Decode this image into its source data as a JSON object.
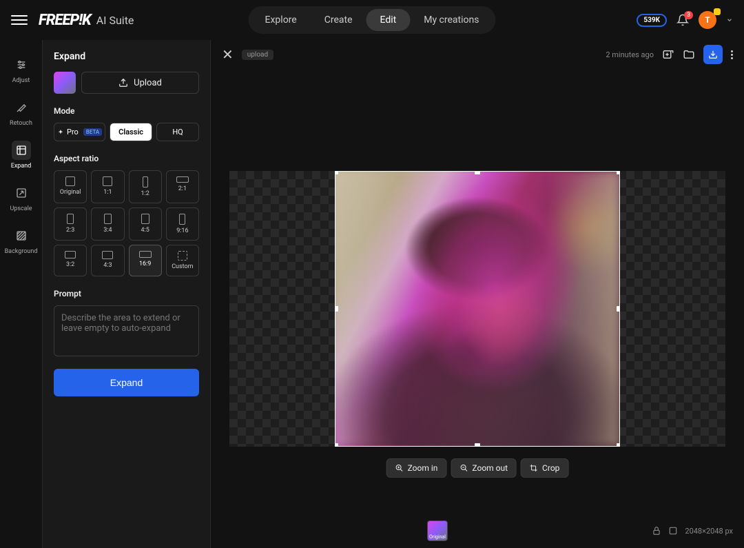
{
  "header": {
    "logo": "FREEP!K",
    "suite": "AI Suite",
    "nav": [
      "Explore",
      "Create",
      "Edit",
      "My creations"
    ],
    "active_nav": "Edit",
    "balance": "539K",
    "notif_count": "3",
    "avatar_letter": "T"
  },
  "rail": {
    "items": [
      {
        "label": "Adjust"
      },
      {
        "label": "Retouch"
      },
      {
        "label": "Expand"
      },
      {
        "label": "Upscale"
      },
      {
        "label": "Background"
      }
    ],
    "active": "Expand"
  },
  "panel": {
    "title": "Expand",
    "upload_label": "Upload",
    "mode_label": "Mode",
    "modes": {
      "pro": "Pro",
      "beta": "BETA",
      "classic": "Classic",
      "hq": "HQ"
    },
    "aspect_label": "Aspect ratio",
    "ratios": [
      "Original",
      "1:1",
      "1:2",
      "2:1",
      "2:3",
      "3:4",
      "4:5",
      "9:16",
      "3:2",
      "4:3",
      "16:9",
      "Custom"
    ],
    "selected_ratio": "16:9",
    "prompt_label": "Prompt",
    "prompt_placeholder": "Describe the area to extend or leave empty to auto-expand",
    "expand_btn": "Expand"
  },
  "canvas": {
    "tag": "upload",
    "time_ago": "2 minutes ago",
    "zoom_in": "Zoom in",
    "zoom_out": "Zoom out",
    "crop": "Crop",
    "original_label": "Original",
    "dimensions": "2048×2048 px"
  }
}
